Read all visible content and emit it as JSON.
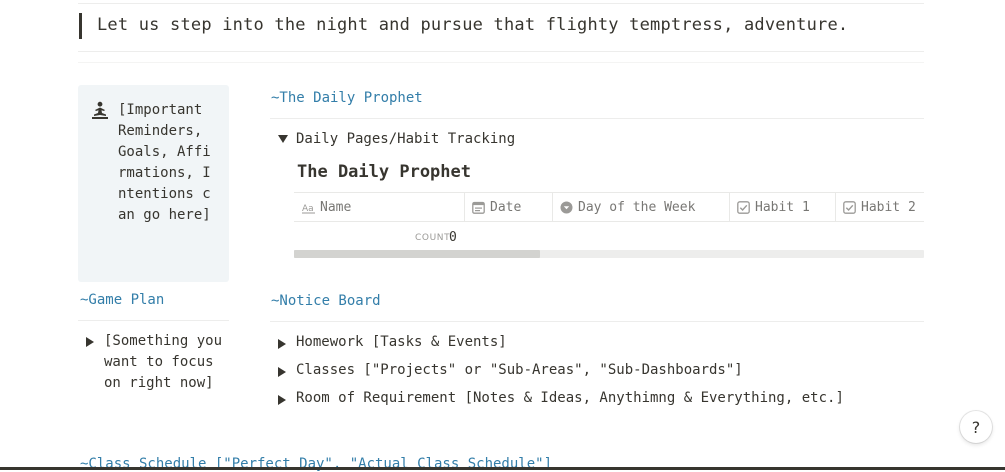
{
  "quote": {
    "text": "Let us step into the night and pursue that flighty temptress, adventure."
  },
  "callout": {
    "icon": "meditating-person-icon",
    "text": "[Important Reminders, Goals, Affirmations, Intentions can go here]"
  },
  "game_plan": {
    "heading": "~Game Plan",
    "toggle_text": "[Something you want to focus on right now]"
  },
  "daily_prophet": {
    "heading": "~The Daily Prophet",
    "toggle_label": "Daily Pages/Habit Tracking",
    "database_title": "The Daily Prophet",
    "columns": [
      {
        "icon": "text-property-icon",
        "label": "Name"
      },
      {
        "icon": "date-property-icon",
        "label": "Date"
      },
      {
        "icon": "select-property-icon",
        "label": "Day of the Week"
      },
      {
        "icon": "checkbox-property-icon",
        "label": "Habit 1"
      },
      {
        "icon": "checkbox-property-icon",
        "label": "Habit 2"
      }
    ],
    "count_label": "COUNT",
    "count_value": "0",
    "scroll_fraction": 0.39
  },
  "notice_board": {
    "heading": "~Notice Board",
    "items": [
      {
        "label": "Homework [Tasks & Events]"
      },
      {
        "label": "Classes [\"Projects\" or \"Sub-Areas\", \"Sub-Dashboards\"]"
      },
      {
        "label": "Room of Requirement [Notes & Ideas, Anythimng & Everything, etc.]"
      }
    ]
  },
  "class_schedule": {
    "heading": "~Class Schedule [\"Perfect Day\", \"Actual Class Schedule\"]"
  },
  "help": {
    "label": "?"
  },
  "colors": {
    "accent_heading": "#337ea9",
    "text": "#37352f",
    "muted": "#787774",
    "callout_bg": "#f1f5f7"
  }
}
